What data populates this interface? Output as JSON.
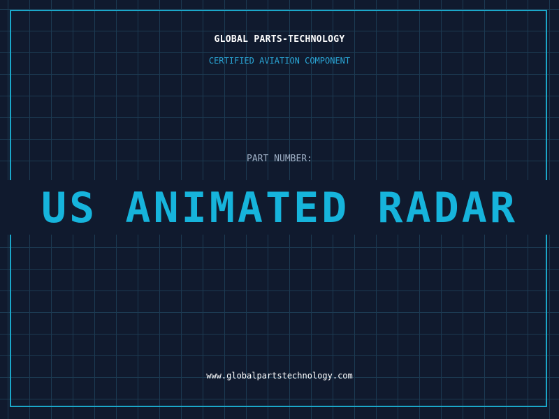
{
  "header": {
    "company": "GLOBAL PARTS-TECHNOLOGY",
    "tagline": "CERTIFIED AVIATION COMPONENT"
  },
  "part": {
    "label": "PART NUMBER:",
    "number": "US ANIMATED RADAR"
  },
  "footer": {
    "website": "www.globalpartstechnology.com"
  },
  "colors": {
    "background": "#101a2e",
    "grid": "#1c3a52",
    "accent": "#1ba7c9",
    "part_number": "#16b4dc"
  }
}
